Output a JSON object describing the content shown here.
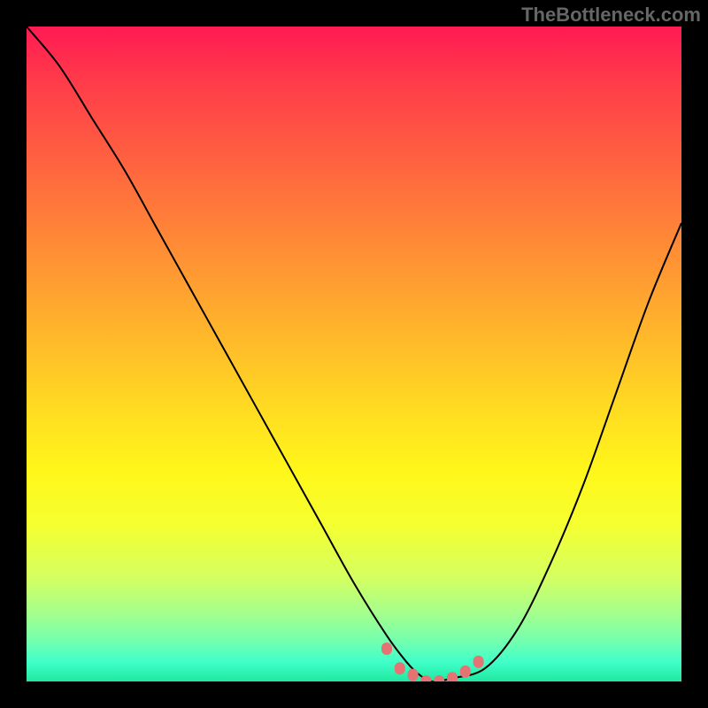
{
  "watermark": "TheBottleneck.com",
  "chart_data": {
    "type": "line",
    "title": "",
    "xlabel": "",
    "ylabel": "",
    "xlim": [
      0,
      100
    ],
    "ylim": [
      0,
      100
    ],
    "background_gradient": {
      "top": "#ff1a53",
      "mid": "#ffda22",
      "bottom": "#20e8a0",
      "description": "red-yellow-green heat where green=optimal"
    },
    "series": [
      {
        "name": "bottleneck-curve",
        "color": "#000000",
        "x": [
          0,
          5,
          10,
          15,
          20,
          25,
          30,
          35,
          40,
          45,
          50,
          55,
          58,
          60,
          62,
          65,
          70,
          75,
          80,
          85,
          90,
          95,
          100
        ],
        "y": [
          100,
          94,
          86,
          78,
          69,
          60,
          51,
          42,
          33,
          24,
          15,
          7,
          3,
          1,
          0,
          0.5,
          2,
          8,
          18,
          30,
          44,
          58,
          70
        ]
      },
      {
        "name": "optimal-markers",
        "color": "#e57373",
        "type": "scatter",
        "x": [
          55,
          57,
          59,
          61,
          63,
          65,
          67,
          69
        ],
        "y": [
          5,
          2,
          1,
          0,
          0,
          0.5,
          1.5,
          3
        ]
      }
    ]
  }
}
